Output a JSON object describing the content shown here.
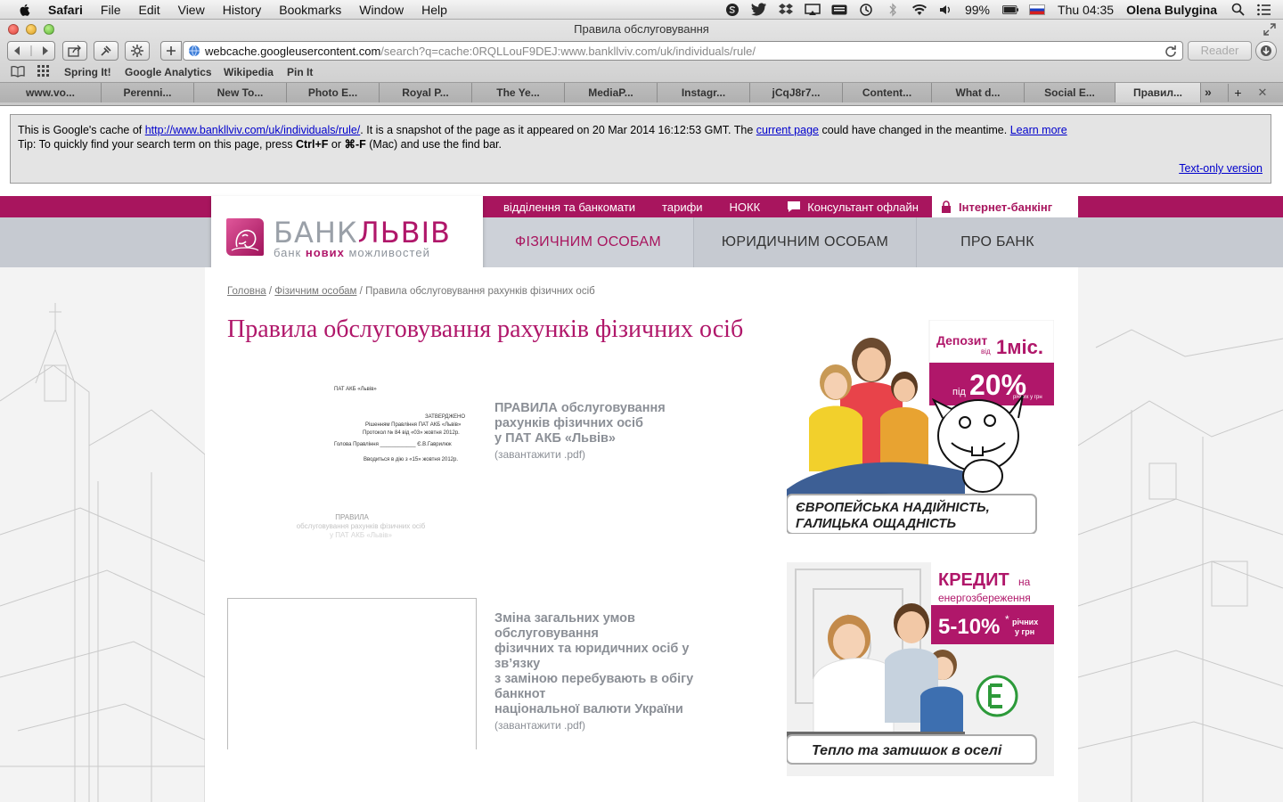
{
  "menubar": {
    "app": "Safari",
    "menus": [
      "File",
      "Edit",
      "View",
      "History",
      "Bookmarks",
      "Window",
      "Help"
    ],
    "battery": "99%",
    "clock": "Thu 04:35",
    "user": "Olena Bulygina"
  },
  "window": {
    "title": "Правила обслуговування"
  },
  "address": {
    "domain": "webcache.googleusercontent.com",
    "path": "/search?q=cache:0RQLLouF9DEJ:www.bankllviv.com/uk/individuals/rule/",
    "reader": "Reader"
  },
  "bookmarks": [
    "Spring It!",
    "Google Analytics",
    "Wikipedia",
    "Pin It"
  ],
  "tabs": [
    "www.vo...",
    "Perenni...",
    "New To...",
    "Photo E...",
    "Royal P...",
    "The Ye...",
    "MediaP...",
    "Instagr...",
    "jCqJ8r7...",
    "Content...",
    "What d...",
    "Social E...",
    "Правил..."
  ],
  "cache": {
    "line1_a": "This is Google's cache of ",
    "url": "http://www.bankllviv.com/uk/individuals/rule/",
    "line1_b": ". It is a snapshot of the page as it appeared on 20 Mar 2014 16:12:53 GMT. The ",
    "current": "current page",
    "line1_c": " could have changed in the meantime. ",
    "learn": "Learn more",
    "tip_a": "Tip: To quickly find your search term on this page, press ",
    "ctrlf": "Ctrl+F",
    "tip_b": " or ",
    "cmdf": "⌘-F",
    "tip_c": " (Mac) and use the find bar.",
    "textonly": "Text-only version"
  },
  "site": {
    "brand_gray": "БАНК",
    "brand_pink": "ЛЬВІВ",
    "slogan_a": "банк ",
    "slogan_b": "нових",
    "slogan_c": " можливостей",
    "toplinks": [
      "відділення та банкомати",
      "тарифи",
      "НОКК"
    ],
    "consultant": "Консультант офлайн",
    "ibank": "Інтернет-банкінг",
    "nav": [
      "ФІЗИЧНИМ ОСОБАМ",
      "ЮРИДИЧНИМ ОСОБАМ",
      "ПРО БАНК"
    ],
    "accent": "#a8155e"
  },
  "crumbs": {
    "home": "Головна",
    "section": "Фізичним особам",
    "current": "Правила обслуговування рахунків фізичних осіб"
  },
  "page_title": "Правила обслуговування рахунків фізичних осіб",
  "thumb1": {
    "org": "ПАТ АКБ «Львів»",
    "approved": "ЗАТВЕРДЖЕНО",
    "decision": "Рішенням Правління ПАТ АКБ «Львів»",
    "protocol": "Протокол № 84 від «03» жовтня 2012р.",
    "head": "Голова Правління ____________ Є.В.Гаврилюк",
    "effective": "Вводиться в дію з «15» жовтня 2012р.",
    "big1": "ПРАВИЛА",
    "big2": "обслуговування рахунків фізичних осіб",
    "big3": "у ПАТ АКБ «Львів»"
  },
  "docs": [
    {
      "lines": [
        "ПРАВИЛА обслуговування",
        "рахунків фізичних осіб",
        "у ПАТ АКБ «Львів»"
      ],
      "link": "(завантажити .pdf)"
    },
    {
      "lines": [
        "Зміна загальних умов",
        "обслуговування",
        "фізичних та юридичних осіб у",
        "зв’язку",
        "з заміною перебувають в обігу",
        "банкнот",
        "національної валюти України"
      ],
      "link": "(завантажити .pdf)"
    }
  ],
  "ad1": {
    "top": "Депозит",
    "from": "від",
    "term": "1міс.",
    "under": "під",
    "rate": "20%",
    "rate_note1": "річних у грн",
    "slogan1": "ЄВРОПЕЙСЬКА НАДІЙНІСТЬ,",
    "slogan2": "ГАЛИЦЬКА ОЩАДНІСТЬ"
  },
  "ad2": {
    "credit": "КРЕДИТ",
    "on": "на",
    "energy": "енергозбереження",
    "rate": "5-10%",
    "star": "*",
    "note1": "річних",
    "note2": "у грн",
    "slogan": "Тепло та затишок в оселі"
  }
}
